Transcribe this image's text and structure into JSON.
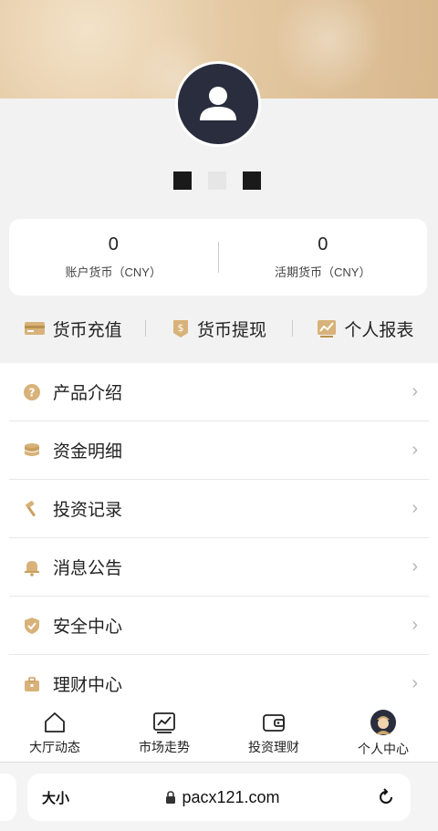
{
  "balances": [
    {
      "value": "0",
      "label": "账户货币（CNY）"
    },
    {
      "value": "0",
      "label": "活期货币（CNY）"
    }
  ],
  "actions": [
    {
      "label": "货币充值",
      "icon": "card-icon"
    },
    {
      "label": "货币提现",
      "icon": "withdraw-icon"
    },
    {
      "label": "个人报表",
      "icon": "report-icon"
    }
  ],
  "menu": [
    {
      "label": "产品介绍",
      "icon": "question-icon"
    },
    {
      "label": "资金明细",
      "icon": "coins-icon"
    },
    {
      "label": "投资记录",
      "icon": "hammer-icon"
    },
    {
      "label": "消息公告",
      "icon": "bell-icon"
    },
    {
      "label": "安全中心",
      "icon": "shield-icon"
    },
    {
      "label": "理财中心",
      "icon": "briefcase-icon"
    }
  ],
  "tabs": [
    {
      "label": "大厅动态",
      "icon": "home-icon"
    },
    {
      "label": "市场走势",
      "icon": "chart-icon"
    },
    {
      "label": "投资理财",
      "icon": "wallet-icon"
    },
    {
      "label": "个人中心",
      "icon": "profile-icon"
    }
  ],
  "browser": {
    "text_size": "大小",
    "url": "pacx121.com"
  },
  "colors": {
    "gold": "#c9a46a",
    "avatar_bg": "#2a2d3d"
  }
}
